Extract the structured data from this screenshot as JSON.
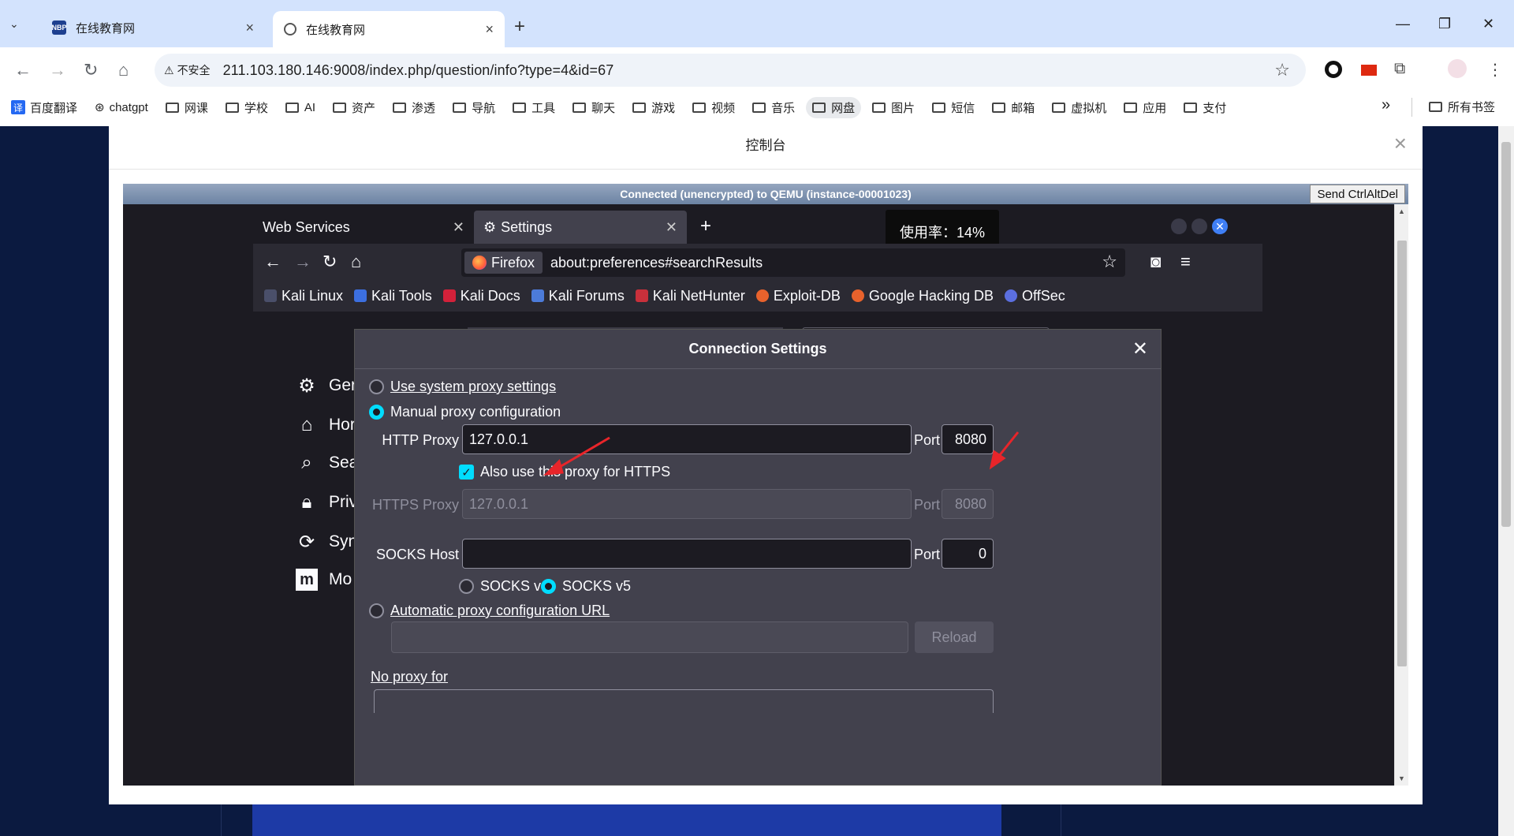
{
  "chrome": {
    "tabs": [
      {
        "title": "在线教育网",
        "active": false
      },
      {
        "title": "在线教育网",
        "active": true
      }
    ],
    "new_tab": "+",
    "insecure_label": "不安全",
    "url": "211.103.180.146:9008/index.php/question/info?type=4&id=67",
    "bookmarks": [
      "百度翻译",
      "chatgpt",
      "网课",
      "学校",
      "AI",
      "资产",
      "渗透",
      "导航",
      "工具",
      "聊天",
      "游戏",
      "视频",
      "音乐",
      "网盘",
      "图片",
      "短信",
      "邮箱",
      "虚拟机",
      "应用",
      "支付"
    ],
    "bookmarks_more": "»",
    "all_bookmarks": "所有书签"
  },
  "console": {
    "title": "控制台",
    "close": "×",
    "vnc_status": "Connected (unencrypted) to QEMU (instance-00001023)",
    "send_cad": "Send CtrlAltDel",
    "usage_tooltip": "使用率：14%"
  },
  "firefox": {
    "tabs": [
      {
        "title": "Web Services"
      },
      {
        "title": "Settings"
      }
    ],
    "identity": "Firefox",
    "url": "about:preferences#searchResults",
    "bookmarks": [
      "Kali Linux",
      "Kali Tools",
      "Kali Docs",
      "Kali Forums",
      "Kali NetHunter",
      "Exploit-DB",
      "Google Hacking DB",
      "OffSec"
    ],
    "sidebar": [
      "Ger",
      "Hor",
      "Sea",
      "Priv",
      "Syn",
      "Mo"
    ]
  },
  "dialog": {
    "title": "Connection Settings",
    "close": "✕",
    "use_system": "Use system proxy settings",
    "manual": "Manual proxy configuration",
    "http_proxy_label": "HTTP Proxy",
    "http_proxy_value": "127.0.0.1",
    "port_label": "Port",
    "http_port_value": "8080",
    "also_https": "Also use this proxy for HTTPS",
    "https_proxy_label": "HTTPS Proxy",
    "https_proxy_value": "127.0.0.1",
    "https_port_value": "8080",
    "socks_host_label": "SOCKS Host",
    "socks_host_value": "",
    "socks_port_value": "0",
    "socks_v4": "SOCKS v4",
    "socks_v5": "SOCKS v5",
    "auto_url": "Automatic proxy configuration URL",
    "auto_url_value": "",
    "reload": "Reload",
    "no_proxy": "No proxy for"
  },
  "colors": {
    "accent": "#00ddff",
    "annotation_arrow": "#e8252a",
    "dialog_bg": "#42414d",
    "chrome_tabstrip": "#d3e3fd"
  }
}
